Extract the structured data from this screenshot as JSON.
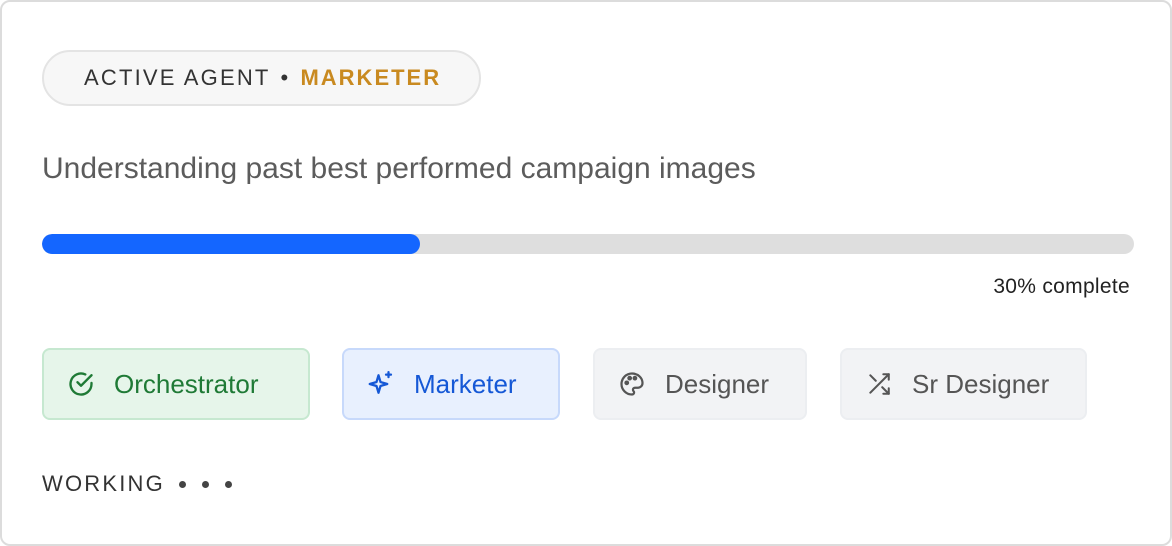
{
  "header": {
    "label": "ACTIVE AGENT",
    "separator": "•",
    "role": "MARKETER",
    "role_color": "#c98a20"
  },
  "task": {
    "description": "Understanding past best performed campaign images"
  },
  "progress": {
    "percent": 30,
    "fill_fraction": 0.346,
    "label": "30% complete",
    "fill_color": "#1466ff",
    "track_color": "#dedede"
  },
  "agents": [
    {
      "label": "Orchestrator",
      "icon": "check-circle-icon",
      "state": "done",
      "color": "#1f7a36"
    },
    {
      "label": "Marketer",
      "icon": "sparkle-icon",
      "state": "active",
      "color": "#1558d6"
    },
    {
      "label": "Designer",
      "icon": "palette-icon",
      "state": "pending",
      "color": "#555555"
    },
    {
      "label": "Sr Designer",
      "icon": "shuffle-icon",
      "state": "pending",
      "color": "#555555"
    }
  ],
  "status": {
    "label": "WORKING"
  }
}
